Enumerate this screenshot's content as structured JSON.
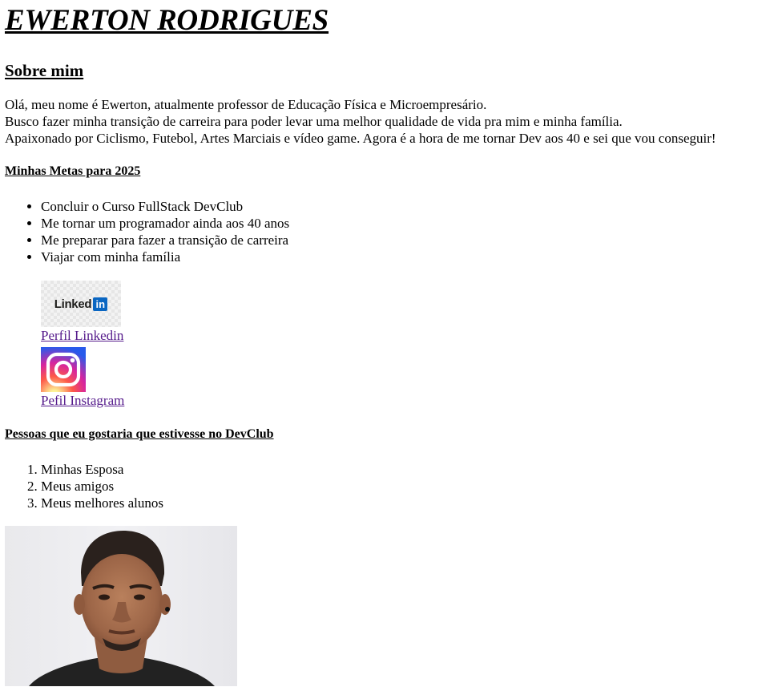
{
  "header": {
    "name": "EWERTON RODRIGUES"
  },
  "about": {
    "title": "Sobre mim",
    "lines": [
      "Olá, meu nome é Ewerton, atualmente professor de Educação Física e Microempresário.",
      "Busco fazer minha transição de carreira para poder levar uma melhor qualidade de vida pra mim e minha família.",
      "Apaixonado por Ciclismo, Futebol, Artes Marciais e vídeo game. Agora é a hora de me tornar Dev aos 40 e sei que vou conseguir!"
    ]
  },
  "goals": {
    "title": "Minhas Metas para 2025",
    "items": [
      "Concluir o Curso FullStack DevClub",
      "Me tornar um programador ainda aos 40 anos",
      "Me preparar para fazer a transição de carreira",
      "Viajar com minha família"
    ]
  },
  "social": {
    "linkedin": {
      "logo_text": "Linked",
      "logo_box": "in",
      "link_label": "Perfil Linkedin",
      "icon": "linkedin-logo"
    },
    "instagram": {
      "link_label": "Pefil Instagram",
      "icon": "instagram-logo"
    }
  },
  "people": {
    "title": "Pessoas que eu gostaria que estivesse no DevClub",
    "items": [
      "Minhas Esposa",
      "Meus amigos",
      "Meus melhores alunos"
    ]
  },
  "colors": {
    "link_visited": "#551a8b",
    "linkedin_blue": "#0a66c2"
  }
}
